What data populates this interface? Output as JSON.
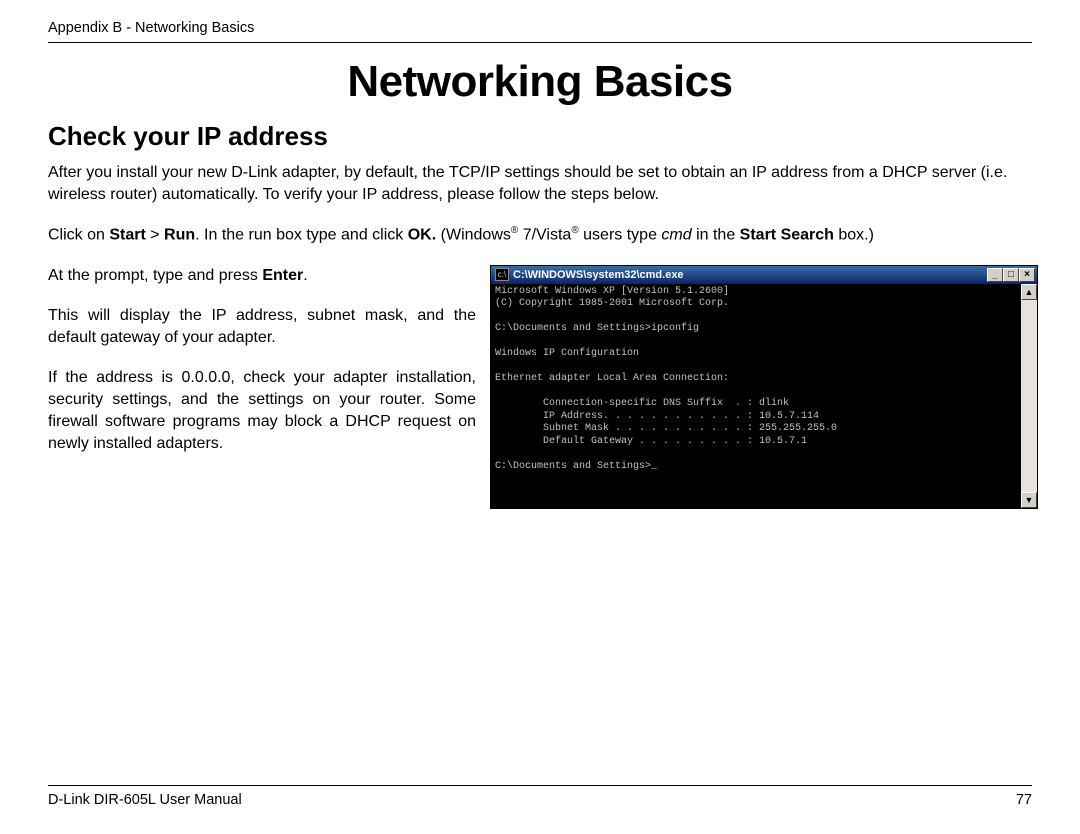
{
  "header": "Appendix B - Networking Basics",
  "title": "Networking Basics",
  "subtitle": "Check your IP address",
  "intro": {
    "p1": "After you install your new D-Link adapter, by default, the TCP/IP settings should be set to obtain an IP address from a DHCP server (i.e. wireless router) automatically. To verify your IP address, please follow the steps below."
  },
  "runline": {
    "a": "Click on ",
    "start": "Start",
    "gt": " > ",
    "run": "Run",
    "b": ". In the run box type ",
    "cmd_placeholder": "   ",
    "c": " and click ",
    "ok": "OK.",
    "d": " (Windows",
    "reg": "®",
    "e": " 7/Vista",
    "f": " users type ",
    "cmd_italic": "cmd",
    "g": " in the ",
    "ss": "Start Search",
    "h": " box.)"
  },
  "left": {
    "p1a": "At the prompt, type ",
    "p1ph": "      ",
    "p1b": " and press ",
    "p1enter": "Enter",
    "p1c": ".",
    "p2": "This will display the IP address, subnet mask, and the default gateway of your adapter.",
    "p3": "If the address is 0.0.0.0, check your adapter installation, security settings, and the settings on your router. Some firewall software programs may block a DHCP request on newly installed adapters."
  },
  "cmd": {
    "title": "C:\\WINDOWS\\system32\\cmd.exe",
    "min": "_",
    "max": "□",
    "close": "×",
    "up": "▲",
    "down": "▼",
    "lines": "Microsoft Windows XP [Version 5.1.2600]\n(C) Copyright 1985-2001 Microsoft Corp.\n\nC:\\Documents and Settings>ipconfig\n\nWindows IP Configuration\n\nEthernet adapter Local Area Connection:\n\n        Connection-specific DNS Suffix  . : dlink\n        IP Address. . . . . . . . . . . . : 10.5.7.114\n        Subnet Mask . . . . . . . . . . . : 255.255.255.0\n        Default Gateway . . . . . . . . . : 10.5.7.1\n\nC:\\Documents and Settings>_"
  },
  "footer": {
    "left": "D-Link DIR-605L User Manual",
    "right": "77"
  }
}
